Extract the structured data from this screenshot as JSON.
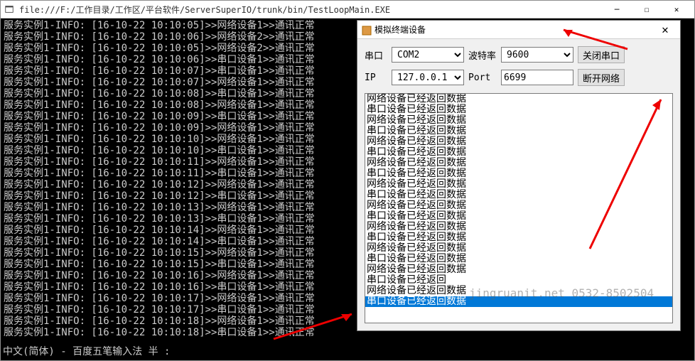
{
  "main": {
    "title": "file:///F:/工作目录/工作区/平台软件/ServerSuperIO/trunk/bin/TestLoopMain.EXE"
  },
  "terminal_lines": [
    "服务实例1-INFO: [16-10-22 10:10:05]>>网络设备1>>通讯正常",
    "服务实例1-INFO: [16-10-22 10:10:06]>>网络设备2>>通讯正常",
    "服务实例1-INFO: [16-10-22 10:10:05]>>网络设备2>>通讯正常",
    "服务实例1-INFO: [16-10-22 10:10:06]>>串口设备1>>通讯正常",
    "服务实例1-INFO: [16-10-22 10:10:07]>>串口设备1>>通讯正常",
    "服务实例1-INFO: [16-10-22 10:10:07]>>网络设备1>>通讯正常",
    "服务实例1-INFO: [16-10-22 10:10:08]>>串口设备1>>通讯正常",
    "服务实例1-INFO: [16-10-22 10:10:08]>>网络设备1>>通讯正常",
    "服务实例1-INFO: [16-10-22 10:10:09]>>串口设备1>>通讯正常",
    "服务实例1-INFO: [16-10-22 10:10:09]>>网络设备1>>通讯正常",
    "服务实例1-INFO: [16-10-22 10:10:10]>>网络设备1>>通讯正常",
    "服务实例1-INFO: [16-10-22 10:10:10]>>串口设备1>>通讯正常",
    "服务实例1-INFO: [16-10-22 10:10:11]>>网络设备1>>通讯正常",
    "服务实例1-INFO: [16-10-22 10:10:11]>>串口设备1>>通讯正常",
    "服务实例1-INFO: [16-10-22 10:10:12]>>网络设备1>>通讯正常",
    "服务实例1-INFO: [16-10-22 10:10:12]>>串口设备1>>通讯正常",
    "服务实例1-INFO: [16-10-22 10:10:13]>>网络设备1>>通讯正常",
    "服务实例1-INFO: [16-10-22 10:10:13]>>串口设备1>>通讯正常",
    "服务实例1-INFO: [16-10-22 10:10:14]>>网络设备1>>通讯正常",
    "服务实例1-INFO: [16-10-22 10:10:14]>>串口设备1>>通讯正常",
    "服务实例1-INFO: [16-10-22 10:10:15]>>网络设备1>>通讯正常",
    "服务实例1-INFO: [16-10-22 10:10:15]>>串口设备1>>通讯正常",
    "服务实例1-INFO: [16-10-22 10:10:16]>>网络设备1>>通讯正常",
    "服务实例1-INFO: [16-10-22 10:10:16]>>串口设备1>>通讯正常",
    "服务实例1-INFO: [16-10-22 10:10:17]>>网络设备1>>通讯正常",
    "服务实例1-INFO: [16-10-22 10:10:17]>>串口设备1>>通讯正常",
    "服务实例1-INFO: [16-10-22 10:10:18]>>网络设备1>>通讯正常",
    "服务实例1-INFO: [16-10-22 10:10:18]>>串口设备1>>通讯正常"
  ],
  "ime": "中文(简体) - 百度五笔输入法 半 :",
  "child": {
    "title": "模拟终端设备",
    "labels": {
      "serial": "串口",
      "baud": "波特率",
      "ip": "IP",
      "port": "Port"
    },
    "values": {
      "serial": "COM2",
      "baud": "9600",
      "ip": "127.0.0.1",
      "port": "6699"
    },
    "buttons": {
      "close_serial": "关闭串口",
      "disconnect": "断开网络"
    },
    "log_lines": [
      "网络设备已经返回数据",
      "串口设备已经返回数据",
      "网络设备已经返回数据",
      "串口设备已经返回数据",
      "网络设备已经返回数据",
      "串口设备已经返回数据",
      "网络设备已经返回数据",
      "串口设备已经返回数据",
      "网络设备已经返回数据",
      "串口设备已经返回数据",
      "网络设备已经返回数据",
      "串口设备已经返回数据",
      "网络设备已经返回数据",
      "串口设备已经返回数据",
      "网络设备已经返回数据",
      "串口设备已经返回数据",
      "网络设备已经返回数据",
      "串口设备已经返回",
      "网络设备已经返回数据",
      "串口设备已经返回数据"
    ],
    "selected_index": 19
  },
  "watermark": "jingruanit.net 0532-8502504"
}
